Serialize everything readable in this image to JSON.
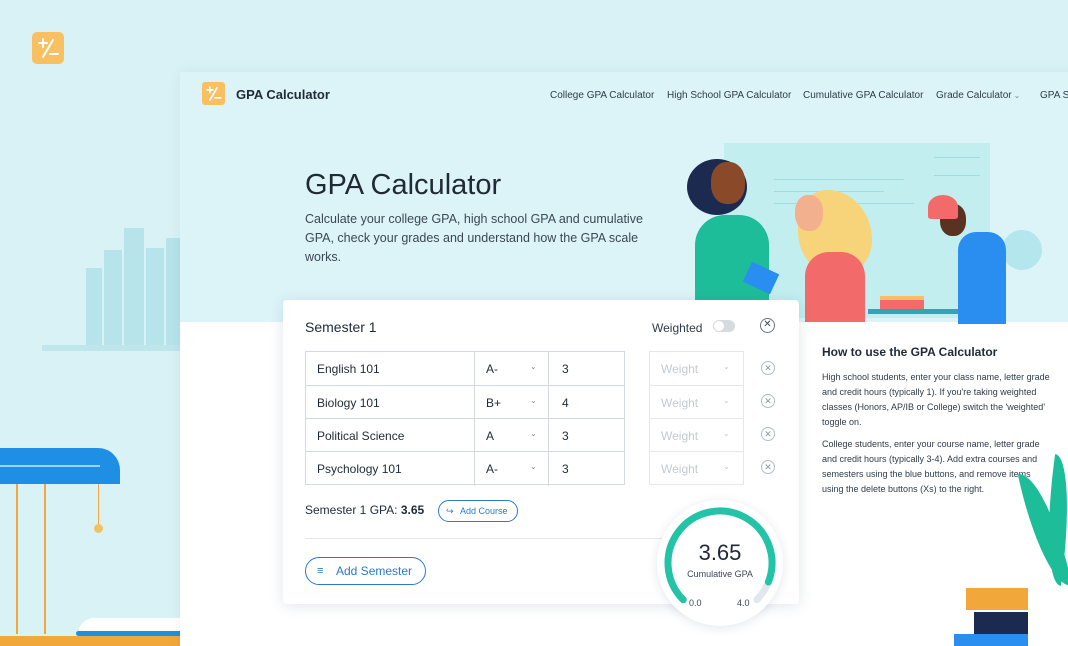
{
  "colors": {
    "accent": "#2a7ad0",
    "brand": "#f9c062",
    "gauge": "#22c3a6"
  },
  "brand": {
    "name": "GPA Calculator",
    "icon": "plus-minus-icon"
  },
  "nav": [
    {
      "label": "College GPA Calculator"
    },
    {
      "label": "High School GPA Calculator"
    },
    {
      "label": "Cumulative GPA Calculator"
    },
    {
      "label": "Grade Calculator",
      "has_dropdown": true
    },
    {
      "label": "GPA Sc"
    }
  ],
  "hero": {
    "title": "GPA Calculator",
    "subtitle": "Calculate your college GPA, high school GPA and cumulative GPA, check your grades and understand how the GPA scale works."
  },
  "semester": {
    "title": "Semester 1",
    "weighted_label": "Weighted",
    "weighted_on": false,
    "courses": [
      {
        "name": "English 101",
        "grade": "A-",
        "credits": "3",
        "weight_placeholder": "Weight"
      },
      {
        "name": "Biology 101",
        "grade": "B+",
        "credits": "4",
        "weight_placeholder": "Weight"
      },
      {
        "name": "Political Science",
        "grade": "A",
        "credits": "3",
        "weight_placeholder": "Weight"
      },
      {
        "name": "Psychology 101",
        "grade": "A-",
        "credits": "3",
        "weight_placeholder": "Weight"
      }
    ],
    "gpa_label": "Semester 1 GPA:",
    "gpa_value": "3.65",
    "add_course_label": "Add Course"
  },
  "add_semester_label": "Add Semester",
  "gauge": {
    "value": "3.65",
    "label": "Cumulative GPA",
    "min": "0.0",
    "max": "4.0",
    "fraction": 0.9125
  },
  "howto": {
    "title": "How to use the GPA Calculator",
    "p1": "High school students, enter your class name, letter grade and credit hours (typically 1). If you're taking weighted classes (Honors, AP/IB or College) switch the 'weighted' toggle on.",
    "p2": "College students, enter your course name, letter grade and credit hours (typically 3-4). Add extra courses and semesters using the blue buttons, and remove items using the delete buttons (Xs) to the right."
  }
}
